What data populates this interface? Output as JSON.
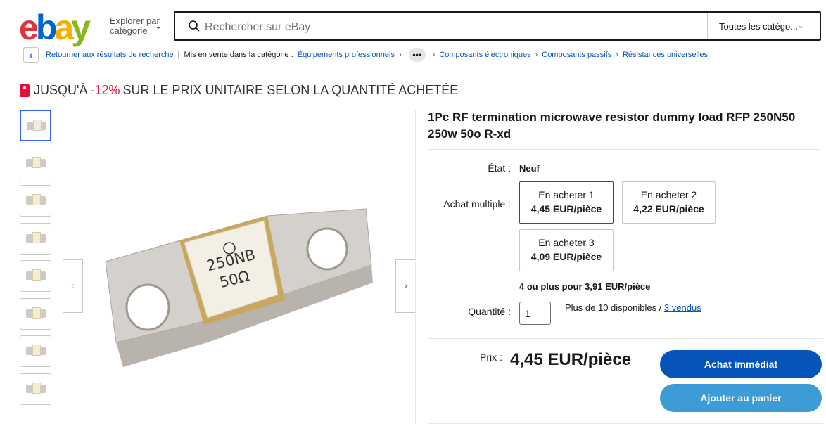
{
  "header": {
    "logo": {
      "e": "e",
      "b": "b",
      "a": "a",
      "y": "y"
    },
    "explore_label": "Explorer par catégorie",
    "search_placeholder": "Rechercher sur eBay",
    "category_select": "Toutes les catégo..."
  },
  "breadcrumb": {
    "back_label": "Retourner aux résultats de recherche",
    "listed_in": "Mis en vente dans la catégorie :",
    "items": [
      "Équipements professionnels",
      "Composants électroniques",
      "Composants passifs",
      "Résistances universelles"
    ]
  },
  "promo": {
    "prefix": "JUSQU'À",
    "discount": "-12%",
    "suffix": "SUR LE PRIX UNITAIRE SELON LA QUANTITÉ ACHETÉE"
  },
  "product": {
    "title": "1Pc RF termination microwave resistor dummy load RFP 250N50 250w 50o R-xd",
    "image_marking": {
      "line1": "250NB",
      "line2": "50Ω"
    },
    "thumbnail_count": 8,
    "condition_label": "État :",
    "condition_value": "Neuf",
    "multi_label": "Achat multiple :",
    "tiers": [
      {
        "qty": "En acheter 1",
        "price": "4,45 EUR/pièce"
      },
      {
        "qty": "En acheter 2",
        "price": "4,22 EUR/pièce"
      },
      {
        "qty": "En acheter 3",
        "price": "4,09 EUR/pièce"
      }
    ],
    "bulk_note": "4 ou plus pour 3,91 EUR/pièce",
    "qty_label": "Quantité :",
    "qty_value": "1",
    "availability": "Plus de 10 disponibles /",
    "sold": "3 vendus",
    "price_label": "Prix :",
    "price": "4,45 EUR/pièce",
    "buy_now": "Achat immédiat",
    "add_to_cart": "Ajouter au panier"
  },
  "colors": {
    "accent": "#0654ba",
    "promo_red": "#e0103a",
    "cart_button": "#3d9bd6"
  }
}
